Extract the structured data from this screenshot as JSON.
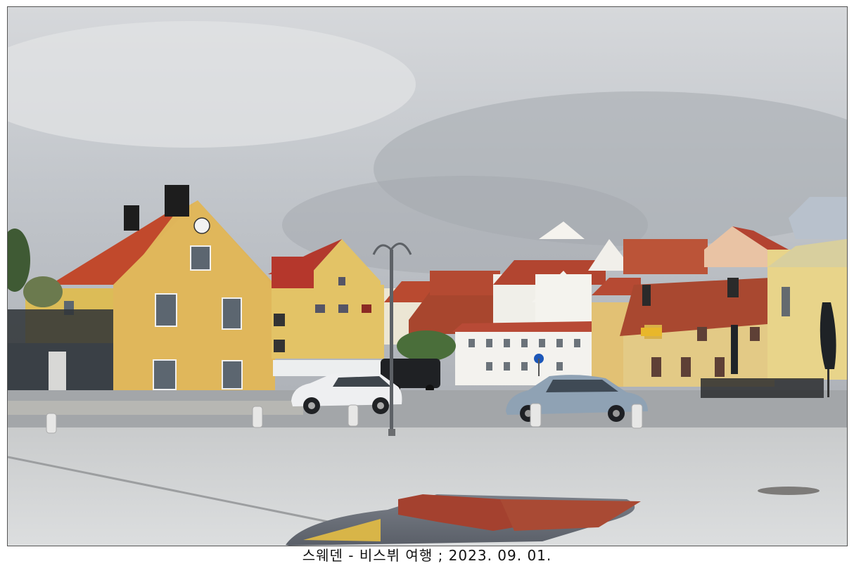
{
  "photo": {
    "scene": "town-square-photo"
  },
  "caption": {
    "text": "스웨덴 - 비스뷔 여행 ; 2023. 09. 01."
  }
}
